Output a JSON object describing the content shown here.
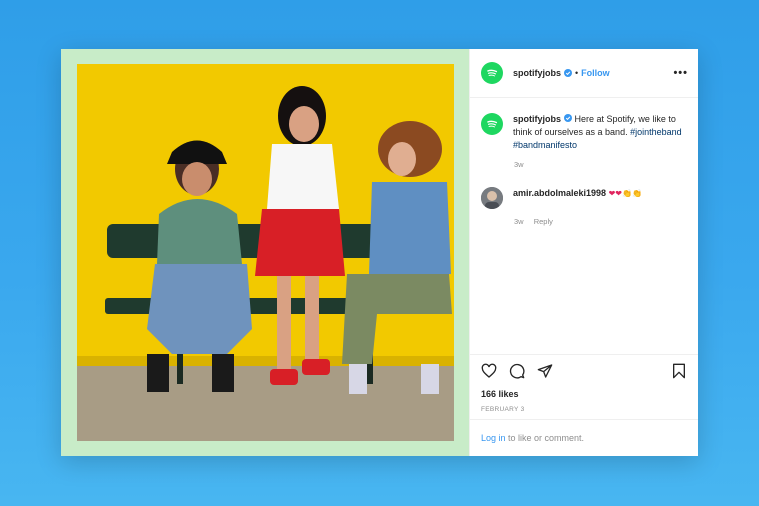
{
  "post": {
    "username": "spotifyjobs",
    "separator": "•",
    "follow_label": "Follow",
    "more_label": "•••",
    "caption_text": " Here at Spotify, we like to think of ourselves as a band. ",
    "hashtags": [
      "#jointheband",
      "#bandmanifesto"
    ],
    "caption_time": "3w"
  },
  "comment": {
    "username": "amir.abdolmaleki1998",
    "emojis": "❤❤👏👏",
    "time": "3w",
    "reply_label": "Reply"
  },
  "stats": {
    "likes": "166 likes",
    "date": "FEBRUARY 3"
  },
  "login": {
    "link": "Log in",
    "rest": " to like or comment."
  },
  "colors": {
    "brand_green": "#1ed760",
    "link_blue": "#3897f0",
    "frame_green": "#c8ecc8",
    "photo_yellow": "#f2c900"
  },
  "icons": [
    "spotify-logo-icon",
    "verified-badge-icon",
    "more-options-icon",
    "heart-icon",
    "comment-icon",
    "share-icon",
    "bookmark-icon"
  ]
}
